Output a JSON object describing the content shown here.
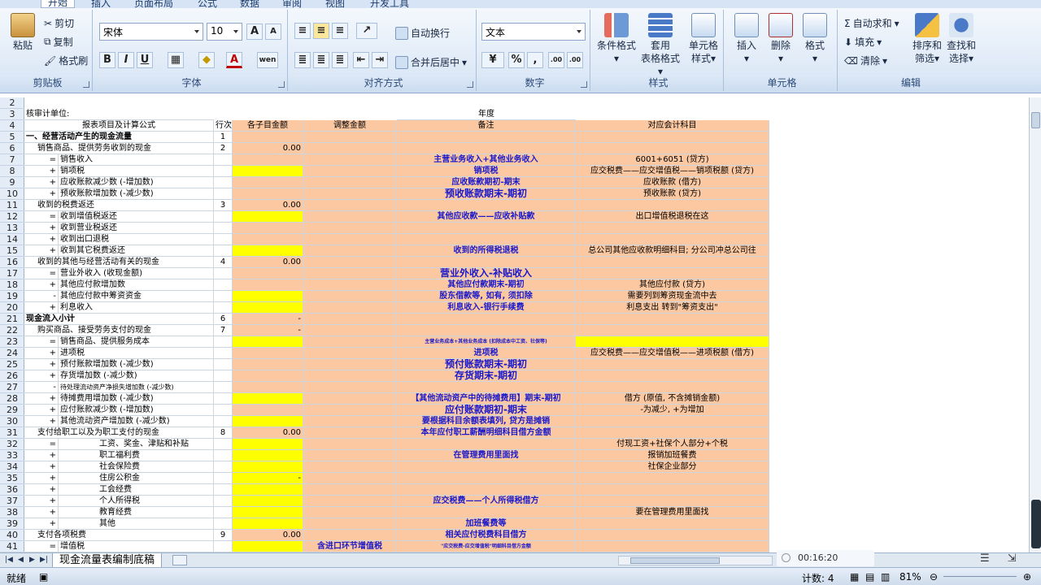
{
  "ribbon": {
    "tabs": [
      "开始",
      "插入",
      "页面布局",
      "公式",
      "数据",
      "审阅",
      "视图",
      "开发工具"
    ],
    "clipboard": {
      "paste": "粘贴",
      "cut": "剪切",
      "copy": "复制",
      "format_painter": "格式刷",
      "label": "剪贴板"
    },
    "font": {
      "name": "宋体",
      "size": "10",
      "label": "字体",
      "bold": "B",
      "italic": "I",
      "underline": "U",
      "grow": "A",
      "shrink": "A",
      "phonetic": "wen"
    },
    "alignment": {
      "wrap": "自动换行",
      "merge": "合并后居中",
      "label": "对齐方式"
    },
    "number": {
      "format": "文本",
      "percent": "%",
      "comma": ",",
      "inc": ".00",
      "dec": ".00",
      "label": "数字"
    },
    "styles": {
      "conditional": "条件格式",
      "table1": "套用",
      "table2": "表格格式",
      "cell1": "单元格",
      "cell2": "样式",
      "label": "样式"
    },
    "cells": {
      "insert": "插入",
      "delete": "删除",
      "format": "格式",
      "label": "单元格"
    },
    "editing": {
      "autosum": "自动求和",
      "fill": "填充",
      "clear": "清除",
      "sort1": "排序和",
      "sort2": "筛选",
      "find1": "查找和",
      "find2": "选择",
      "label": "编辑"
    }
  },
  "row_numbers": [
    "2",
    "3",
    "4",
    "5",
    "6",
    "7",
    "8",
    "9",
    "10",
    "11",
    "12",
    "13",
    "14",
    "15",
    "16",
    "17",
    "18",
    "19",
    "20",
    "21",
    "22",
    "23",
    "24",
    "25",
    "26",
    "27",
    "28",
    "29",
    "30",
    "31",
    "32",
    "33",
    "34",
    "35",
    "36",
    "37",
    "38",
    "39",
    "40",
    "41"
  ],
  "header_rows": {
    "r3_a": "核审计单位:",
    "r3_year": "年度",
    "r4": [
      "报表项目及计算公式",
      "行次",
      "各子目金额",
      "调整金额",
      "备注",
      "对应会计科目"
    ]
  },
  "rows": [
    {
      "op": "",
      "item": "一、经营活动产生的现金流量",
      "line": "1",
      "amt": "",
      "note": "",
      "acct": "",
      "b": true
    },
    {
      "op": "",
      "item": "销售商品、提供劳务收到的现金",
      "line": "2",
      "amt": "0.00",
      "note": "",
      "acct": ""
    },
    {
      "op": "=",
      "item": "销售收入",
      "line": "",
      "amt": "",
      "note": "主营业务收入+其他业务收入",
      "acct": "6001+6051 (贷方)"
    },
    {
      "op": "+",
      "item": "销项税",
      "line": "",
      "amt": "",
      "note": "销项税",
      "acct": "应交税费——应交增值税——销项税额 (贷方)",
      "y": true
    },
    {
      "op": "+",
      "item": "应收账款减少数 (-增加数)",
      "line": "",
      "amt": "",
      "note": "应收账款期初-期末",
      "acct": "应收账款 (借方)"
    },
    {
      "op": "+",
      "item": "预收账款增加数 (-减少数)",
      "line": "",
      "amt": "",
      "note": "预收账款期末-期初",
      "acct": "预收账款 (贷方)",
      "big": true
    },
    {
      "op": "",
      "item": "收到的税费返还",
      "line": "3",
      "amt": "0.00",
      "note": "",
      "acct": ""
    },
    {
      "op": "=",
      "item": "收到增值税返还",
      "line": "",
      "amt": "",
      "note": "其他应收款——应收补贴款",
      "acct": "出口增值税退税在这",
      "y": true
    },
    {
      "op": "+",
      "item": "收到营业税返还",
      "line": "",
      "amt": "",
      "note": "",
      "acct": ""
    },
    {
      "op": "+",
      "item": "收到出口退税",
      "line": "",
      "amt": "",
      "note": "",
      "acct": ""
    },
    {
      "op": "+",
      "item": "收到其它税费返还",
      "line": "",
      "amt": "",
      "note": "收到的所得税退税",
      "acct": "总公司其他应收款明细科目; 分公司冲总公司往",
      "y": true
    },
    {
      "op": "",
      "item": "收到的其他与经营活动有关的现金",
      "line": "4",
      "amt": "0.00",
      "note": "",
      "acct": ""
    },
    {
      "op": "=",
      "item": "营业外收入 (收现金额)",
      "line": "",
      "amt": "",
      "note": "营业外收入-补贴收入",
      "acct": "",
      "big": true
    },
    {
      "op": "+",
      "item": "其他应付款增加数",
      "line": "",
      "amt": "",
      "note": "其他应付款期末-期初",
      "acct": "其他应付款 (贷方)"
    },
    {
      "op": "-",
      "item": "其他应付款中筹资资金",
      "line": "",
      "amt": "",
      "note": "股东借款等, 如有, 须扣除",
      "acct": "需要列到筹资现金流中去",
      "y": true
    },
    {
      "op": "+",
      "item": "利息收入",
      "line": "",
      "amt": "",
      "note": "利息收入-银行手续费",
      "acct": "利息支出 转到\"筹资支出\"",
      "y": true
    },
    {
      "op": "",
      "item": "现金流入小计",
      "line": "6",
      "amt": "-",
      "note": "",
      "acct": "",
      "b": true
    },
    {
      "op": "",
      "item": "购买商品、接受劳务支付的现金",
      "line": "7",
      "amt": "-",
      "note": "",
      "acct": ""
    },
    {
      "op": "=",
      "item": "销售商品、提供服务成本",
      "line": "",
      "amt": "",
      "note": "主营业务成本+其他业务成本 (扣除成本中工资、社保等)",
      "acct": "",
      "y": true,
      "tiny": true,
      "acctY": true
    },
    {
      "op": "+",
      "item": "进项税",
      "line": "",
      "amt": "",
      "note": "进项税",
      "acct": "应交税费——应交增值税——进项税额 (借方)"
    },
    {
      "op": "+",
      "item": "预付账款增加数 (-减少数)",
      "line": "",
      "amt": "",
      "note": "预付账款期末-期初",
      "acct": "",
      "big": true
    },
    {
      "op": "+",
      "item": "存货增加数 (-减少数)",
      "line": "",
      "amt": "",
      "note": "存货期末-期初",
      "acct": "",
      "big": true
    },
    {
      "op": "-",
      "item": "待处理流动资产净损失增加数 (-减少数)",
      "line": "",
      "amt": "",
      "note": "",
      "acct": "",
      "small": true
    },
    {
      "op": "+",
      "item": "待摊费用增加数 (-减少数)",
      "line": "",
      "amt": "",
      "note": "【其他流动资产中的待摊费用】期末-期初",
      "acct": "借方 (原值, 不含摊销金额)",
      "y": true
    },
    {
      "op": "+",
      "item": "应付账款减少数 (-增加数)",
      "line": "",
      "amt": "",
      "note": "应付账款期初-期末",
      "acct": "-为减少, +为增加",
      "big": true
    },
    {
      "op": "+",
      "item": "其他流动资产增加数 (-减少数)",
      "line": "",
      "amt": "",
      "note": "要根据科目余额表填列, 贷方是摊销",
      "acct": "",
      "y": true
    },
    {
      "op": "",
      "item": "支付给职工以及为职工支付的现金",
      "line": "8",
      "amt": "0.00",
      "note": "本年应付职工薪酬明细科目借方金额",
      "acct": ""
    },
    {
      "op": "=",
      "item": "工资、奖金、津贴和补贴",
      "line": "",
      "amt": "",
      "note": "",
      "acct": "付现工资+社保个人部分+个税",
      "indent": true,
      "y": true
    },
    {
      "op": "+",
      "item": "职工福利费",
      "line": "",
      "amt": "",
      "note": "在管理费用里面找",
      "acct": "报销加班餐费",
      "indent": true,
      "y": true
    },
    {
      "op": "+",
      "item": "社会保险费",
      "line": "",
      "amt": "",
      "note": "",
      "acct": "社保企业部分",
      "indent": true,
      "y": true
    },
    {
      "op": "+",
      "item": "住房公积金",
      "line": "",
      "amt": "-",
      "note": "",
      "acct": "",
      "indent": true,
      "y": true
    },
    {
      "op": "+",
      "item": "工会经费",
      "line": "",
      "amt": "",
      "note": "",
      "acct": "",
      "indent": true,
      "y": true
    },
    {
      "op": "+",
      "item": "个人所得税",
      "line": "",
      "amt": "",
      "note": "应交税费——个人所得税借方",
      "acct": "",
      "indent": true,
      "y": true
    },
    {
      "op": "+",
      "item": "教育经费",
      "line": "",
      "amt": "",
      "note": "",
      "acct": "要在管理费用里面找",
      "indent": true,
      "y": true
    },
    {
      "op": "+",
      "item": "其他",
      "line": "",
      "amt": "",
      "note": "加班餐费等",
      "acct": "",
      "indent": true,
      "y": true
    },
    {
      "op": "",
      "item": "支付各项税费",
      "line": "9",
      "amt": "0.00",
      "note": "相关应付税费科目借方",
      "acct": ""
    },
    {
      "op": "=",
      "item": "增值税",
      "line": "",
      "amt": "",
      "adj": "含进口环节增值税",
      "note": "\"应交税费-应交增值税\"明细科目借方金额",
      "acct": "",
      "y": true,
      "tiny": true
    }
  ],
  "sheet_tab": "现金流量表编制底稿",
  "status": {
    "ready": "就绪",
    "count": "计数: 4",
    "zoom": "81%",
    "timer": "00:16:20"
  }
}
